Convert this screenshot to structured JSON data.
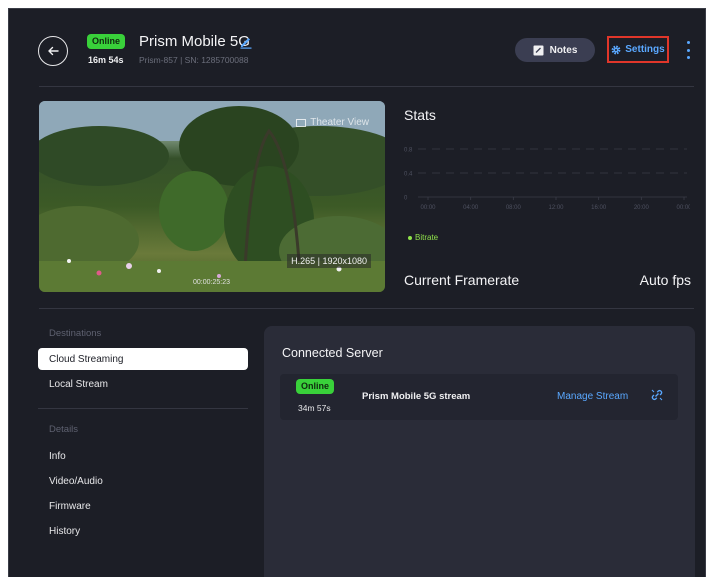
{
  "header": {
    "status_badge": "Online",
    "uptime": "16m 54s",
    "device_name": "Prism Mobile 5G",
    "device_meta": "Prism-857 | SN: 1285700088",
    "notes_label": "Notes",
    "settings_label": "Settings"
  },
  "video": {
    "theater_label": "Theater View",
    "codec": "H.265 | 1920x1080",
    "timestamp": "00:00:25:23"
  },
  "stats": {
    "title": "Stats",
    "legend_label": "Bitrate",
    "framerate_label": "Current Framerate",
    "framerate_value": "Auto fps"
  },
  "chart_data": {
    "type": "line",
    "x": [
      "00:00",
      "04:00",
      "08:00",
      "12:00",
      "16:00",
      "20:00",
      "00:00"
    ],
    "yticks": [
      "0.8",
      "0.4",
      "0"
    ],
    "ylim": [
      0,
      0.8
    ],
    "series": [
      {
        "name": "Bitrate",
        "values": []
      }
    ],
    "grid": true,
    "legend": "bottom-left",
    "color": "#8fe34a"
  },
  "sidebar": {
    "destinations_heading": "Destinations",
    "destinations": [
      "Cloud Streaming",
      "Local Stream"
    ],
    "details_heading": "Details",
    "details": [
      "Info",
      "Video/Audio",
      "Firmware",
      "History"
    ]
  },
  "panel": {
    "title": "Connected Server",
    "server": {
      "status": "Online",
      "uptime": "34m 57s",
      "name": "Prism Mobile 5G stream",
      "manage_label": "Manage Stream"
    }
  },
  "colors": {
    "background": "#1c1e26",
    "online": "#39d13a",
    "accent": "#5aa8ff",
    "highlight": "#e0362a"
  }
}
